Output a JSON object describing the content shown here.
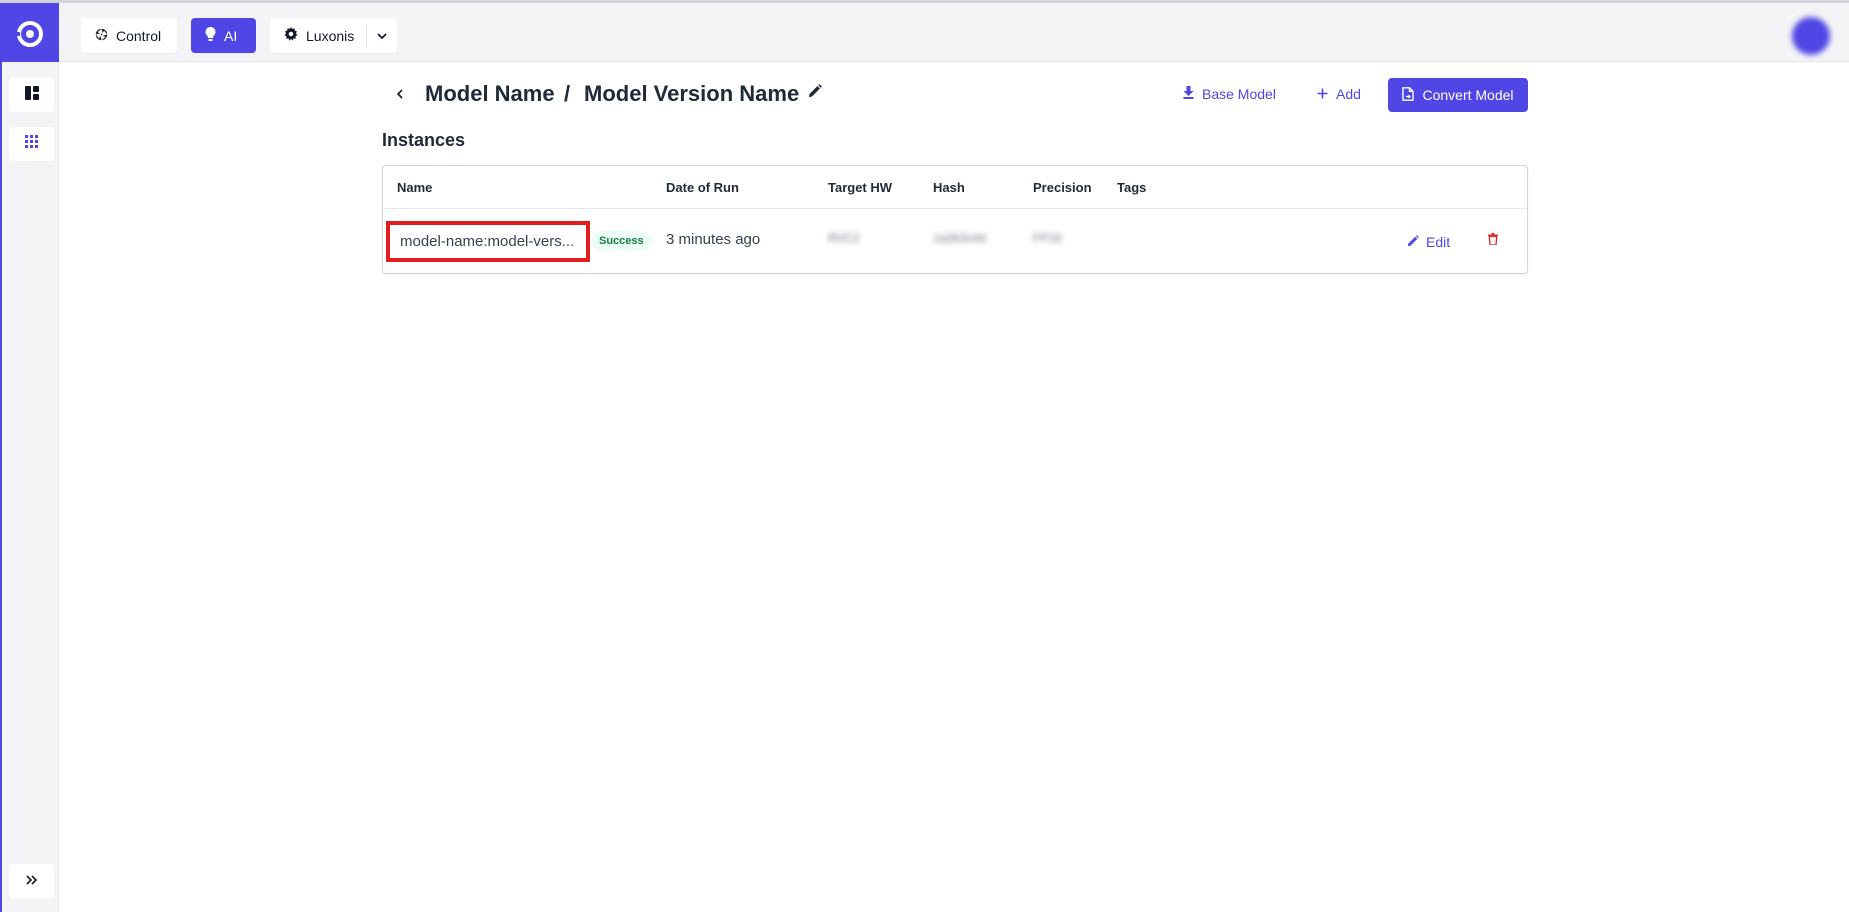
{
  "nav": {
    "control_label": "Control",
    "ai_label": "AI",
    "org_label": "Luxonis"
  },
  "header": {
    "model_name": "Model Name",
    "separator": "/",
    "version_name": "Model Version Name",
    "base_model_label": "Base Model",
    "add_label": "Add",
    "convert_label": "Convert Model"
  },
  "section": {
    "title": "Instances"
  },
  "table": {
    "columns": [
      "Name",
      "Date of Run",
      "Target HW",
      "Hash",
      "Precision",
      "Tags"
    ],
    "rows": [
      {
        "name": "model-name:model-vers...",
        "status": "Success",
        "date_of_run": "3 minutes ago",
        "target_hw": "RVC2",
        "hash": "1a2b3c4d",
        "precision": "FP16",
        "edit_label": "Edit"
      }
    ]
  },
  "colors": {
    "accent": "#4f46e5",
    "success_bg": "#ecfdf5",
    "success_text": "#15803d",
    "danger": "#dc2626",
    "highlight": "#e11d1d"
  },
  "icons": {
    "logo": "luxonis-logo",
    "control": "aperture-icon",
    "ai": "lightbulb-icon",
    "org": "gear-icon",
    "back": "chevron-left-icon",
    "edit": "pencil-icon",
    "base_model": "download-icon",
    "add": "plus-icon",
    "convert": "file-convert-icon",
    "delete": "trash-icon"
  }
}
